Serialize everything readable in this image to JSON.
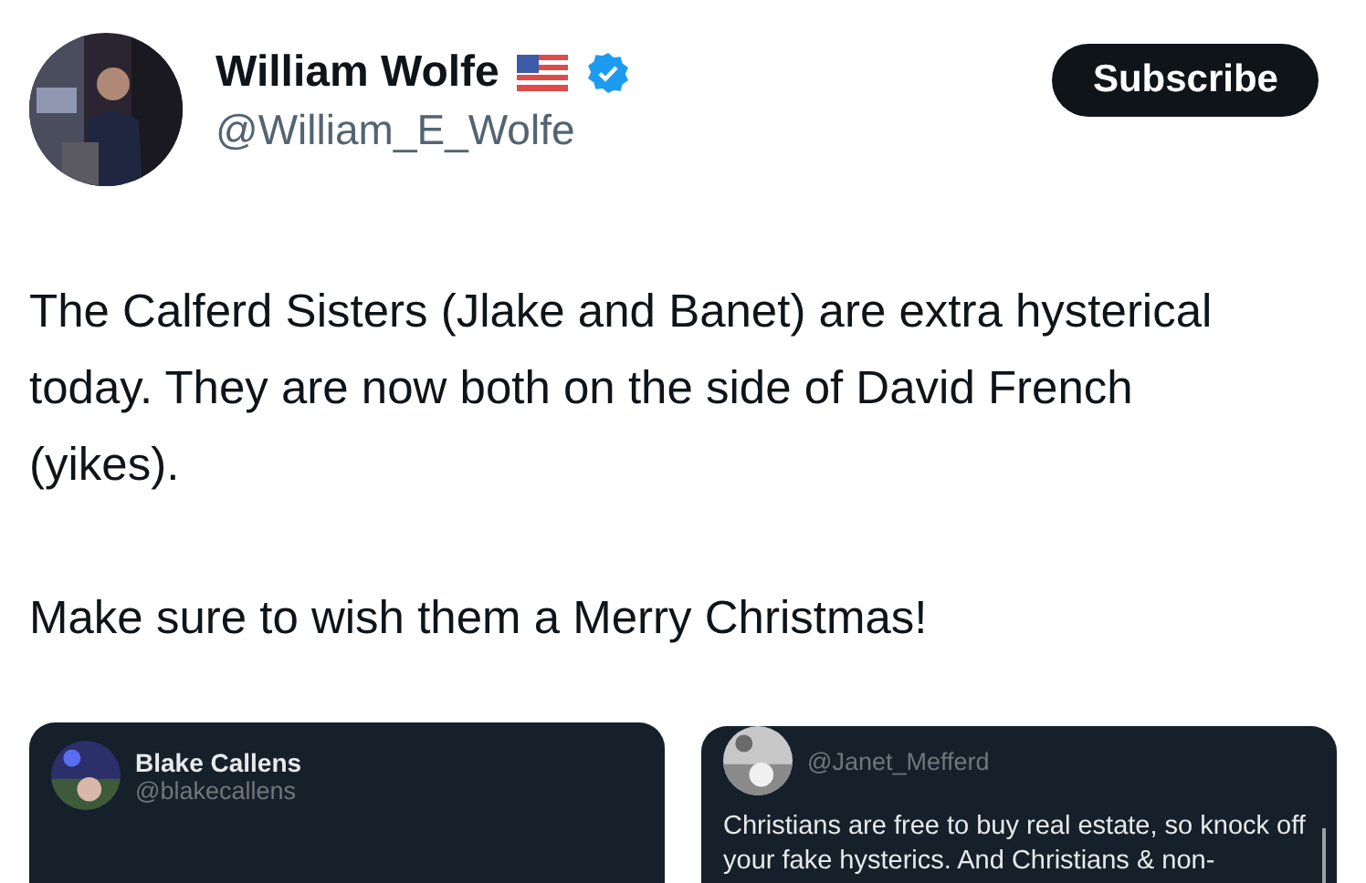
{
  "author": {
    "name": "William Wolfe",
    "handle": "@William_E_Wolfe",
    "verified": true
  },
  "subscribe_button": "Subscribe",
  "paragraphs": [
    "The Calferd Sisters (Jlake and Banet) are extra hysterical today. They are now both on the side of David French (yikes).",
    "Make sure to wish them a Merry Christmas!"
  ],
  "quoted_posts": [
    {
      "name": "Blake Callens",
      "handle": "@blakecallens"
    },
    {
      "handle": "@Janet_Mefferd",
      "lines": [
        "Christians are free to buy real estate, so knock off",
        "your fake hysterics. And Christians & non-"
      ]
    }
  ]
}
